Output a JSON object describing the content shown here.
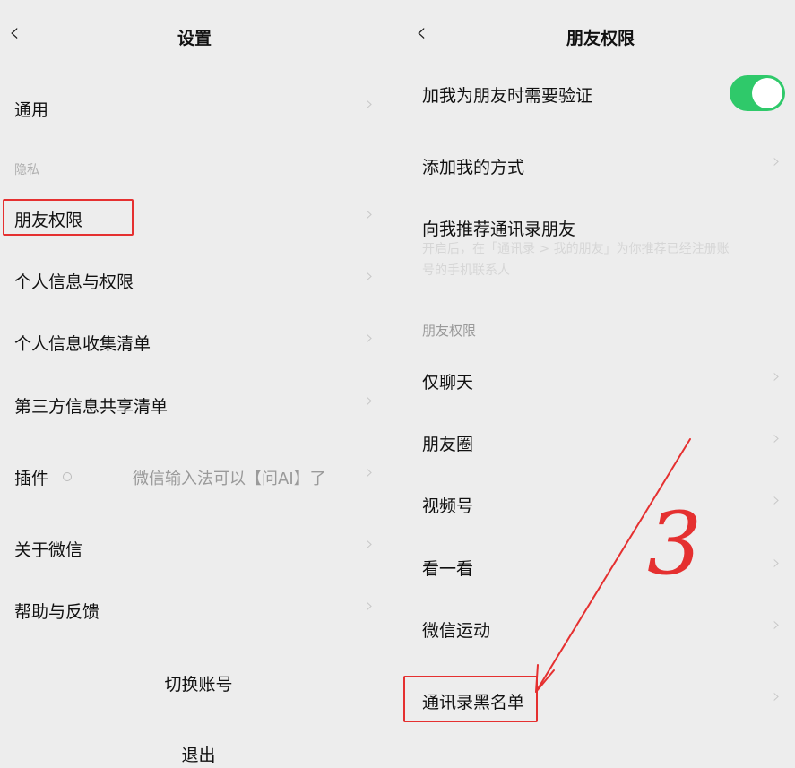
{
  "left": {
    "title": "设置",
    "back_icon": "chevron-left-icon",
    "items": [
      {
        "label": "通用"
      },
      {
        "label": "朋友权限"
      },
      {
        "label": "个人信息与权限"
      },
      {
        "label": "个人信息收集清单"
      },
      {
        "label": "第三方信息共享清单"
      },
      {
        "label": "插件",
        "value": "微信输入法可以【问AI】了"
      },
      {
        "label": "关于微信"
      },
      {
        "label": "帮助与反馈"
      }
    ],
    "section_privacy": "隐私",
    "switch_account": "切换账号",
    "logout": "退出"
  },
  "right": {
    "title": "朋友权限",
    "back_icon": "chevron-left-icon",
    "verify_label": "加我为朋友时需要验证",
    "verify_enabled": true,
    "add_methods": "添加我的方式",
    "recommend_label": "向我推荐通讯录朋友",
    "recommend_desc": "开启后，在「通讯录 > 我的朋友」为你推荐已经注册账号的手机联系人",
    "section_friend_permissions": "朋友权限",
    "items": [
      {
        "label": "仅聊天"
      },
      {
        "label": "朋友圈"
      },
      {
        "label": "视频号"
      },
      {
        "label": "看一看"
      },
      {
        "label": "微信运动"
      },
      {
        "label": "通讯录黑名单"
      }
    ]
  },
  "annotation": {
    "number": "3",
    "color": "#e53030"
  },
  "colors": {
    "background": "#ededed",
    "toggle_on": "#2fc96a",
    "highlight": "#e53030"
  }
}
